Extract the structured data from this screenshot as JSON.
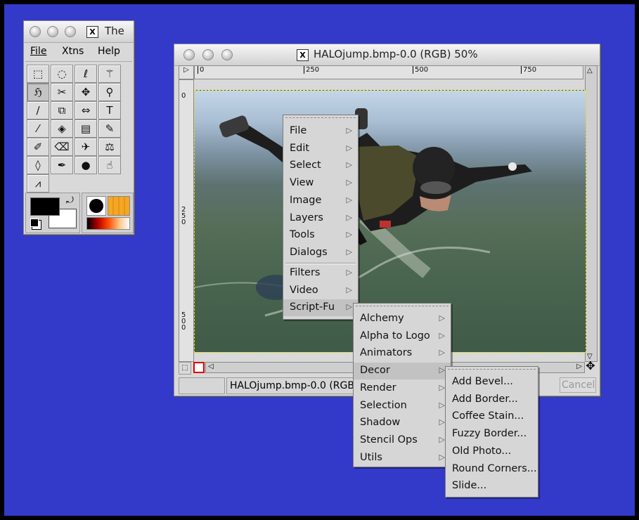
{
  "toolbox": {
    "title": "The",
    "menus": [
      "File",
      "Xtns",
      "Help"
    ]
  },
  "tools": [
    {
      "name": "rect-select-icon",
      "glyph": "⬚"
    },
    {
      "name": "ellipse-select-icon",
      "glyph": "◌"
    },
    {
      "name": "lasso-icon",
      "glyph": "ℓ"
    },
    {
      "name": "magic-wand-icon",
      "glyph": "⚚"
    },
    {
      "name": "bezier-select-icon",
      "glyph": "ℌ"
    },
    {
      "name": "scissors-icon",
      "glyph": "✂"
    },
    {
      "name": "move-icon",
      "glyph": "✥"
    },
    {
      "name": "zoom-icon",
      "glyph": "⚲"
    },
    {
      "name": "crop-icon",
      "glyph": "∕"
    },
    {
      "name": "transform-icon",
      "glyph": "⧉"
    },
    {
      "name": "flip-icon",
      "glyph": "⇔"
    },
    {
      "name": "text-icon",
      "glyph": "T"
    },
    {
      "name": "color-picker-icon",
      "glyph": "⁄"
    },
    {
      "name": "bucket-fill-icon",
      "glyph": "◈"
    },
    {
      "name": "blend-icon",
      "glyph": "▤"
    },
    {
      "name": "pencil-icon",
      "glyph": "✎"
    },
    {
      "name": "paintbrush-icon",
      "glyph": "✐"
    },
    {
      "name": "eraser-icon",
      "glyph": "⌫"
    },
    {
      "name": "airbrush-icon",
      "glyph": "✈"
    },
    {
      "name": "clone-stamp-icon",
      "glyph": "⚖"
    },
    {
      "name": "blur-icon",
      "glyph": "◊"
    },
    {
      "name": "ink-icon",
      "glyph": "✒"
    },
    {
      "name": "dodge-burn-icon",
      "glyph": "●"
    },
    {
      "name": "smudge-icon",
      "glyph": "☝"
    },
    {
      "name": "measure-icon",
      "glyph": "⩘"
    }
  ],
  "image_window": {
    "title": "HALOjump.bmp-0.0 (RGB) 50%",
    "ruler_h": [
      "0",
      "250",
      "500",
      "750"
    ],
    "ruler_v": [
      "0",
      "250",
      "500"
    ],
    "status": "HALOjump.bmp-0.0 (RGB)",
    "cancel": "Cancel"
  },
  "context_menu": {
    "items": [
      "File",
      "Edit",
      "Select",
      "View",
      "Image",
      "Layers",
      "Tools",
      "Dialogs"
    ],
    "items2": [
      "Filters",
      "Video",
      "Script-Fu"
    ]
  },
  "scriptfu_menu": [
    "Alchemy",
    "Alpha to Logo",
    "Animators",
    "Decor",
    "Render",
    "Selection",
    "Shadow",
    "Stencil Ops",
    "Utils"
  ],
  "decor_menu": [
    "Add Bevel...",
    "Add Border...",
    "Coffee Stain...",
    "Fuzzy Border...",
    "Old Photo...",
    "Round Corners...",
    "Slide..."
  ],
  "colors": {
    "desktop": "#3339c8",
    "fg": "#000000",
    "bg": "#ffffff",
    "brush_pattern": "#f5a623"
  }
}
